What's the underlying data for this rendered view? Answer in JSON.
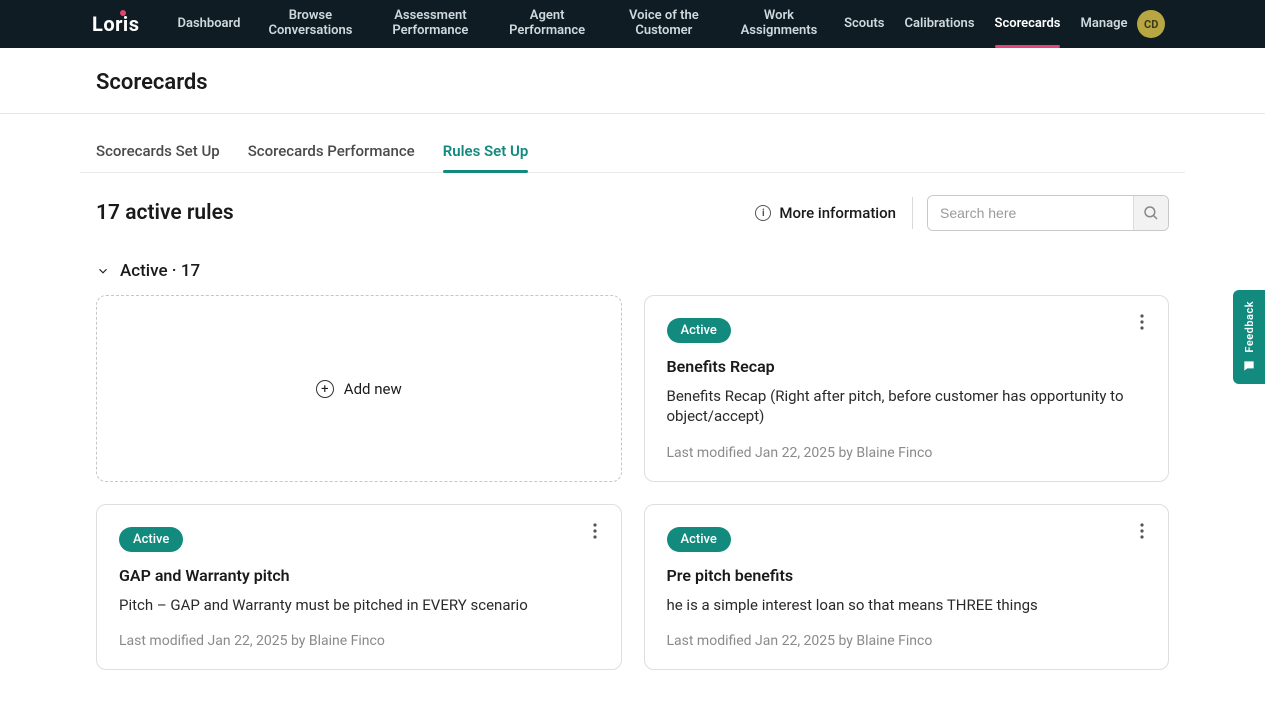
{
  "brand": "Loris",
  "nav": {
    "items": [
      "Dashboard",
      "Browse Conversations",
      "Assessment Performance",
      "Agent Performance",
      "Voice of the Customer",
      "Work Assignments",
      "Scouts",
      "Calibrations",
      "Scorecards",
      "Manage"
    ],
    "active_index": 8,
    "avatar_initials": "CD"
  },
  "page": {
    "title": "Scorecards"
  },
  "tabs": {
    "items": [
      "Scorecards Set Up",
      "Scorecards Performance",
      "Rules Set Up"
    ],
    "active_index": 2
  },
  "toolbar": {
    "count_label": "17 active rules",
    "more_info_label": "More information",
    "search_placeholder": "Search here"
  },
  "section": {
    "label": "Active · 17",
    "add_new_label": "Add new"
  },
  "cards": [
    {
      "status": "Active",
      "title": "Benefits Recap",
      "desc": "Benefits Recap (Right after pitch, before customer has opportunity to object/accept)",
      "meta": "Last modified Jan 22, 2025 by Blaine Finco"
    },
    {
      "status": "Active",
      "title": "GAP and Warranty pitch",
      "desc": "Pitch – GAP and Warranty must be pitched in EVERY scenario",
      "meta": "Last modified Jan 22, 2025 by Blaine Finco"
    },
    {
      "status": "Active",
      "title": "Pre pitch benefits",
      "desc": "he is a simple interest loan so that means THREE things",
      "meta": "Last modified Jan 22, 2025 by Blaine Finco"
    }
  ],
  "feedback_label": "Feedback"
}
